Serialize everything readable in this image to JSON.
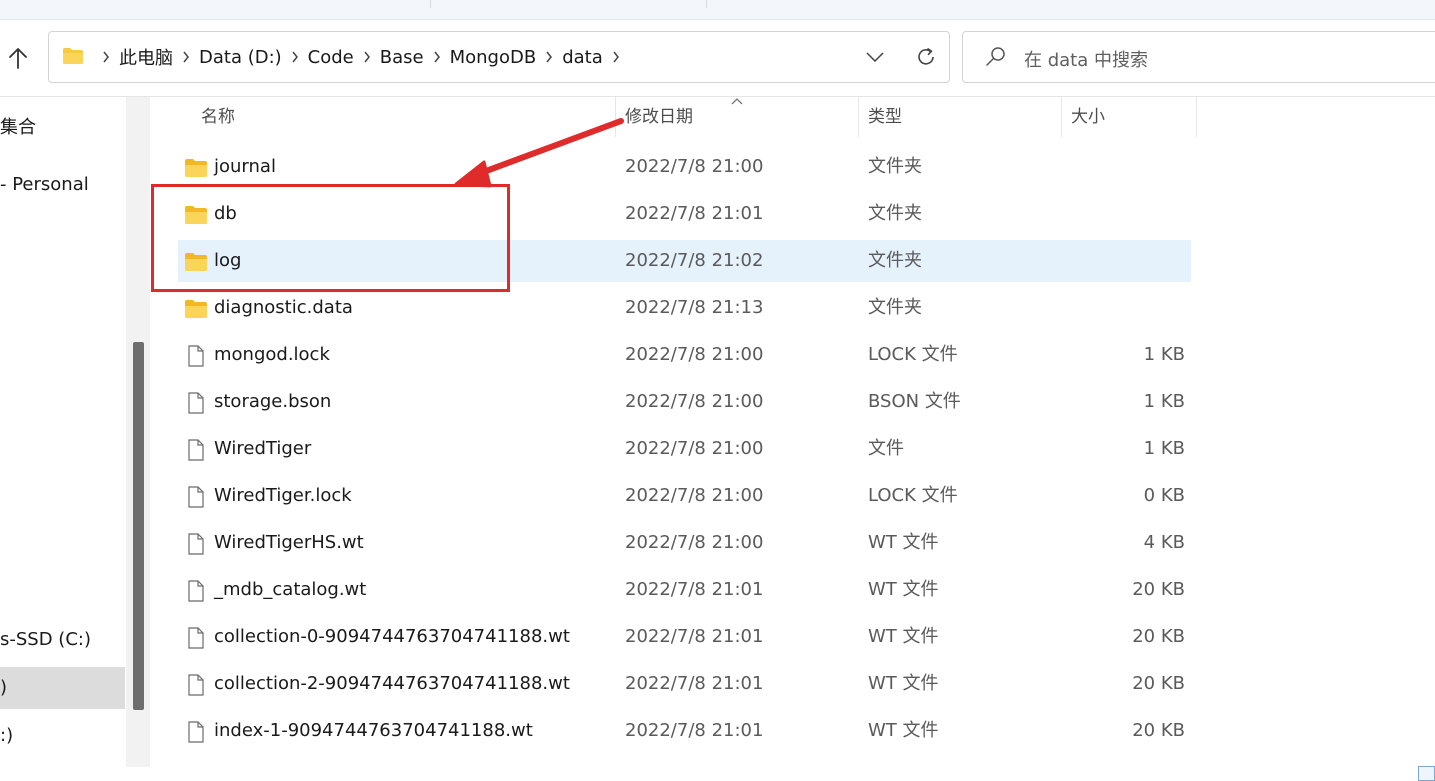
{
  "address_bar": {
    "crumbs": [
      "此电脑",
      "Data (D:)",
      "Code",
      "Base",
      "MongoDB",
      "data"
    ]
  },
  "search": {
    "placeholder": "在 data 中搜索"
  },
  "nav": {
    "items": [
      {
        "label": "集合"
      },
      {
        "label": "- Personal"
      },
      {
        "label": "s-SSD (C:)"
      },
      {
        "label": ")"
      },
      {
        "label": ":)"
      }
    ]
  },
  "columns": {
    "name": "名称",
    "date": "修改日期",
    "type": "类型",
    "size": "大小"
  },
  "files": [
    {
      "name": "journal",
      "date": "2022/7/8 21:00",
      "type": "文件夹",
      "size": "",
      "icon": "folder-icon"
    },
    {
      "name": "db",
      "date": "2022/7/8 21:01",
      "type": "文件夹",
      "size": "",
      "icon": "folder-icon"
    },
    {
      "name": "log",
      "date": "2022/7/8 21:02",
      "type": "文件夹",
      "size": "",
      "icon": "folder-icon"
    },
    {
      "name": "diagnostic.data",
      "date": "2022/7/8 21:13",
      "type": "文件夹",
      "size": "",
      "icon": "folder-icon"
    },
    {
      "name": "mongod.lock",
      "date": "2022/7/8 21:00",
      "type": "LOCK 文件",
      "size": "1 KB",
      "icon": "file-icon"
    },
    {
      "name": "storage.bson",
      "date": "2022/7/8 21:00",
      "type": "BSON 文件",
      "size": "1 KB",
      "icon": "file-icon"
    },
    {
      "name": "WiredTiger",
      "date": "2022/7/8 21:00",
      "type": "文件",
      "size": "1 KB",
      "icon": "file-icon"
    },
    {
      "name": "WiredTiger.lock",
      "date": "2022/7/8 21:00",
      "type": "LOCK 文件",
      "size": "0 KB",
      "icon": "file-icon"
    },
    {
      "name": "WiredTigerHS.wt",
      "date": "2022/7/8 21:00",
      "type": "WT 文件",
      "size": "4 KB",
      "icon": "file-icon"
    },
    {
      "name": "_mdb_catalog.wt",
      "date": "2022/7/8 21:01",
      "type": "WT 文件",
      "size": "20 KB",
      "icon": "file-icon"
    },
    {
      "name": "collection-0-9094744763704741188.wt",
      "date": "2022/7/8 21:01",
      "type": "WT 文件",
      "size": "20 KB",
      "icon": "file-icon"
    },
    {
      "name": "collection-2-9094744763704741188.wt",
      "date": "2022/7/8 21:01",
      "type": "WT 文件",
      "size": "20 KB",
      "icon": "file-icon"
    },
    {
      "name": "index-1-9094744763704741188.wt",
      "date": "2022/7/8 21:01",
      "type": "WT 文件",
      "size": "20 KB",
      "icon": "file-icon"
    }
  ],
  "selected_file": "log",
  "colors": {
    "selection": "#e5f1fb",
    "annotation": "#e02b2b",
    "folder": "#f8c940"
  }
}
